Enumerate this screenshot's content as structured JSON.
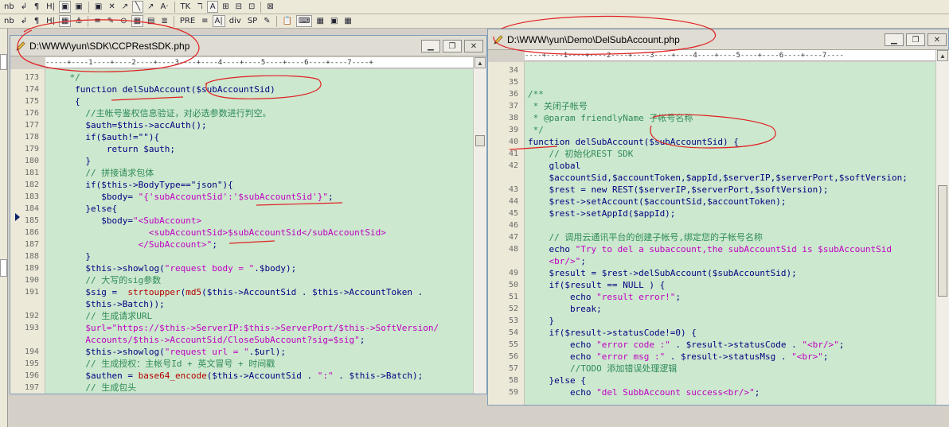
{
  "toolbar_row1": [
    "nb",
    "↲",
    "¶",
    "H|",
    "▣",
    "▣",
    "▣",
    "✕",
    "↗",
    "╲",
    "↗",
    "A·",
    "TK",
    "ℸ",
    "A",
    "⊞",
    "⊟",
    "⊡",
    "⊠"
  ],
  "toolbar_row2": [
    "nb",
    "↲",
    "¶",
    "H|",
    "▦",
    "⚓",
    "≡",
    "✎",
    "⊙",
    "▦",
    "▤",
    "≣",
    "PRE",
    "≡",
    "A|",
    "div",
    "SP",
    "✎",
    "📋",
    "⌨",
    "▦",
    "▣",
    "▦"
  ],
  "left_window": {
    "title": "D:\\WWW\\yun\\SDK\\CCPRestSDK.php",
    "ruler": "-----+----1----+----2----+----3----+----4----+----5----+----6----+----7----+",
    "lines": [
      {
        "n": "173",
        "parts": [
          {
            "t": "    */",
            "c": "c-com"
          }
        ]
      },
      {
        "n": "174",
        "parts": [
          {
            "t": "     function delSubAccount($subAccountSid)",
            "c": "c-key"
          }
        ]
      },
      {
        "n": "175",
        "parts": [
          {
            "t": "     {",
            "c": "c-key"
          }
        ]
      },
      {
        "n": "176",
        "parts": [
          {
            "t": "       //主帐号鉴权信息验证，对必选参数进行判空。",
            "c": "c-com"
          }
        ]
      },
      {
        "n": "177",
        "parts": [
          {
            "t": "       $auth=$this->accAuth();",
            "c": "c-key"
          }
        ]
      },
      {
        "n": "178",
        "parts": [
          {
            "t": "       if($auth!=\"\"){",
            "c": "c-key"
          }
        ]
      },
      {
        "n": "179",
        "parts": [
          {
            "t": "           return $auth;",
            "c": "c-key"
          }
        ]
      },
      {
        "n": "180",
        "parts": [
          {
            "t": "       }",
            "c": "c-key"
          }
        ]
      },
      {
        "n": "181",
        "parts": [
          {
            "t": "       // 拼接请求包体",
            "c": "c-com"
          }
        ]
      },
      {
        "n": "182",
        "parts": [
          {
            "t": "       if($this->BodyType==\"json\"){",
            "c": "c-key"
          }
        ]
      },
      {
        "n": "183",
        "parts": [
          {
            "t": "          $body= ",
            "c": "c-key"
          },
          {
            "t": "\"{'subAccountSid':'$subAccountSid'}\"",
            "c": "c-str"
          },
          {
            "t": ";",
            "c": "c-key"
          }
        ]
      },
      {
        "n": "184",
        "parts": [
          {
            "t": "       }else{",
            "c": "c-key"
          }
        ]
      },
      {
        "n": "185",
        "parts": [
          {
            "t": "          $body=",
            "c": "c-key"
          },
          {
            "t": "\"<SubAccount>",
            "c": "c-str"
          }
        ]
      },
      {
        "n": "186",
        "parts": [
          {
            "t": "                   <subAccountSid>$subAccountSid</subAccountSid>",
            "c": "c-str"
          }
        ]
      },
      {
        "n": "187",
        "parts": [
          {
            "t": "                 </SubAccount>\"",
            "c": "c-str"
          },
          {
            "t": ";",
            "c": "c-key"
          }
        ]
      },
      {
        "n": "188",
        "parts": [
          {
            "t": "       }",
            "c": "c-key"
          }
        ]
      },
      {
        "n": "189",
        "parts": [
          {
            "t": "       $this->showlog(",
            "c": "c-key"
          },
          {
            "t": "\"request body = \"",
            "c": "c-str"
          },
          {
            "t": ".$body);",
            "c": "c-key"
          }
        ]
      },
      {
        "n": "190",
        "parts": [
          {
            "t": "       // 大写的sig参数",
            "c": "c-com"
          }
        ]
      },
      {
        "n": "191",
        "parts": [
          {
            "t": "       $sig =  ",
            "c": "c-key"
          },
          {
            "t": "strtoupper",
            "c": "c-fn"
          },
          {
            "t": "(",
            "c": "c-key"
          },
          {
            "t": "md5",
            "c": "c-fn"
          },
          {
            "t": "($this->AccountSid . $this->AccountToken .",
            "c": "c-key"
          }
        ]
      },
      {
        "n": "",
        "parts": [
          {
            "t": "       $this->Batch));",
            "c": "c-key"
          }
        ]
      },
      {
        "n": "192",
        "parts": [
          {
            "t": "       // 生成请求URL",
            "c": "c-com"
          }
        ]
      },
      {
        "n": "193",
        "parts": [
          {
            "t": "       $url=\"https://$this->ServerIP:$this->ServerPort/$this->SoftVersion/",
            "c": "c-str"
          }
        ]
      },
      {
        "n": "",
        "parts": [
          {
            "t": "       Accounts/$this->AccountSid/CloseSubAccount?sig=$sig\"",
            "c": "c-str"
          },
          {
            "t": ";",
            "c": "c-key"
          }
        ]
      },
      {
        "n": "194",
        "parts": [
          {
            "t": "       $this->showlog(",
            "c": "c-key"
          },
          {
            "t": "\"request url = \"",
            "c": "c-str"
          },
          {
            "t": ".$url);",
            "c": "c-key"
          }
        ]
      },
      {
        "n": "195",
        "parts": [
          {
            "t": "       // 生成授权：主帐号Id + 英文冒号 + 时间戳",
            "c": "c-com"
          }
        ]
      },
      {
        "n": "196",
        "parts": [
          {
            "t": "       $authen = ",
            "c": "c-key"
          },
          {
            "t": "base64_encode",
            "c": "c-fn"
          },
          {
            "t": "($this->AccountSid . ",
            "c": "c-key"
          },
          {
            "t": "\":\"",
            "c": "c-str"
          },
          {
            "t": " . $this->Batch);",
            "c": "c-key"
          }
        ]
      },
      {
        "n": "197",
        "parts": [
          {
            "t": "       // 生成包头",
            "c": "c-com"
          }
        ]
      }
    ]
  },
  "right_window": {
    "title": "D:\\WWW\\yun\\Demo\\DelSubAccount.php",
    "ruler": "----+----1----+----2----+----3----+----4----+----5----+----6----+----7----",
    "lines": [
      {
        "n": "34",
        "parts": [
          {
            "t": "",
            "c": "c-key"
          }
        ]
      },
      {
        "n": "35",
        "parts": [
          {
            "t": "",
            "c": "c-key"
          }
        ]
      },
      {
        "n": "36",
        "parts": [
          {
            "t": "/**",
            "c": "c-com"
          }
        ]
      },
      {
        "n": "37",
        "parts": [
          {
            "t": " * 关闭子帐号",
            "c": "c-com"
          }
        ]
      },
      {
        "n": "38",
        "parts": [
          {
            "t": " * @param friendlyName 子帐号名称",
            "c": "c-com"
          }
        ]
      },
      {
        "n": "39",
        "parts": [
          {
            "t": " */",
            "c": "c-com"
          }
        ]
      },
      {
        "n": "40",
        "parts": [
          {
            "t": "function delSubAccount($subAccountSid) {",
            "c": "c-key"
          }
        ]
      },
      {
        "n": "41",
        "parts": [
          {
            "t": "    // 初始化REST SDK",
            "c": "c-com"
          }
        ]
      },
      {
        "n": "42",
        "parts": [
          {
            "t": "    global",
            "c": "c-key"
          }
        ]
      },
      {
        "n": "",
        "parts": [
          {
            "t": "    $accountSid,$accountToken,$appId,$serverIP,$serverPort,$softVersion;",
            "c": "c-key"
          }
        ]
      },
      {
        "n": "43",
        "parts": [
          {
            "t": "    $rest = new REST($serverIP,$serverPort,$softVersion);",
            "c": "c-key"
          }
        ]
      },
      {
        "n": "44",
        "parts": [
          {
            "t": "    $rest->setAccount($accountSid,$accountToken);",
            "c": "c-key"
          }
        ]
      },
      {
        "n": "45",
        "parts": [
          {
            "t": "    $rest->setAppId($appId);",
            "c": "c-key"
          }
        ]
      },
      {
        "n": "46",
        "parts": [
          {
            "t": "",
            "c": "c-key"
          }
        ]
      },
      {
        "n": "47",
        "parts": [
          {
            "t": "    // 调用云通讯平台的创建子帐号,绑定您的子帐号名称",
            "c": "c-com"
          }
        ]
      },
      {
        "n": "48",
        "parts": [
          {
            "t": "    echo ",
            "c": "c-key"
          },
          {
            "t": "\"Try to del a subaccount,the subAccountSid is $subAccountSid",
            "c": "c-str"
          }
        ]
      },
      {
        "n": "",
        "parts": [
          {
            "t": "    <br/>\"",
            "c": "c-str"
          },
          {
            "t": ";",
            "c": "c-key"
          }
        ]
      },
      {
        "n": "49",
        "parts": [
          {
            "t": "    $result = $rest->delSubAccount($subAccountSid);",
            "c": "c-key"
          }
        ]
      },
      {
        "n": "50",
        "parts": [
          {
            "t": "    if($result == NULL ) {",
            "c": "c-key"
          }
        ]
      },
      {
        "n": "51",
        "parts": [
          {
            "t": "        echo ",
            "c": "c-key"
          },
          {
            "t": "\"result error!\"",
            "c": "c-str"
          },
          {
            "t": ";",
            "c": "c-key"
          }
        ]
      },
      {
        "n": "52",
        "parts": [
          {
            "t": "        break;",
            "c": "c-key"
          }
        ]
      },
      {
        "n": "53",
        "parts": [
          {
            "t": "    }",
            "c": "c-key"
          }
        ]
      },
      {
        "n": "54",
        "parts": [
          {
            "t": "    if($result->statusCode!=0) {",
            "c": "c-key"
          }
        ]
      },
      {
        "n": "55",
        "parts": [
          {
            "t": "        echo ",
            "c": "c-key"
          },
          {
            "t": "\"error code :\"",
            "c": "c-str"
          },
          {
            "t": " . $result->statusCode . ",
            "c": "c-key"
          },
          {
            "t": "\"<br/>\"",
            "c": "c-str"
          },
          {
            "t": ";",
            "c": "c-key"
          }
        ]
      },
      {
        "n": "56",
        "parts": [
          {
            "t": "        echo ",
            "c": "c-key"
          },
          {
            "t": "\"error msg :\"",
            "c": "c-str"
          },
          {
            "t": " . $result->statusMsg . ",
            "c": "c-key"
          },
          {
            "t": "\"<br>\"",
            "c": "c-str"
          },
          {
            "t": ";",
            "c": "c-key"
          }
        ]
      },
      {
        "n": "57",
        "parts": [
          {
            "t": "        //TODO 添加错误处理逻辑",
            "c": "c-com"
          }
        ]
      },
      {
        "n": "58",
        "parts": [
          {
            "t": "    }else {",
            "c": "c-key"
          }
        ]
      },
      {
        "n": "59",
        "parts": [
          {
            "t": "        echo ",
            "c": "c-key"
          },
          {
            "t": "\"del SubbAccount success<br/>\"",
            "c": "c-str"
          },
          {
            "t": ";",
            "c": "c-key"
          }
        ]
      }
    ]
  },
  "window_buttons": {
    "minimize": "▁",
    "restore": "❐",
    "close": "✕"
  },
  "colors": {
    "editor_bg": "#cce8cf",
    "comment": "#2e8b57",
    "string": "#c000c0",
    "function": "#b40000",
    "keyword": "#000080",
    "annotation": "#e02020"
  }
}
